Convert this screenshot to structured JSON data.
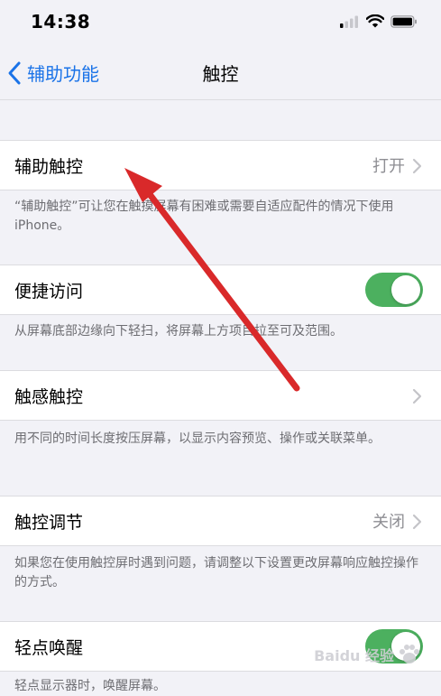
{
  "status_bar": {
    "time": "14:38"
  },
  "nav": {
    "back_label": "辅助功能",
    "title": "触控"
  },
  "rows": [
    {
      "label": "辅助触控",
      "value": "打开",
      "footer": "“辅助触控”可让您在触摸屏幕有困难或需要自适应配件的情况下使用iPhone。"
    },
    {
      "label": "便捷访问",
      "toggle_on": true,
      "footer": "从屏幕底部边缘向下轻扫，将屏幕上方项目拉至可及范围。"
    },
    {
      "label": "触感触控",
      "value": "",
      "footer": "用不同的时间长度按压屏幕，以显示内容预览、操作或关联菜单。"
    },
    {
      "label": "触控调节",
      "value": "关闭",
      "footer": "如果您在使用触控屏时遇到问题，请调整以下设置更改屏幕响应触控操作的方式。"
    },
    {
      "label": "轻点唤醒",
      "toggle_on": true,
      "footer": "轻点显示器时，唤醒屏幕。"
    }
  ],
  "watermark": {
    "text": "Baidu 经验"
  },
  "colors": {
    "accent": "#1a73e8",
    "toggle_on": "#4cb05f",
    "arrow": "#d9292a"
  }
}
